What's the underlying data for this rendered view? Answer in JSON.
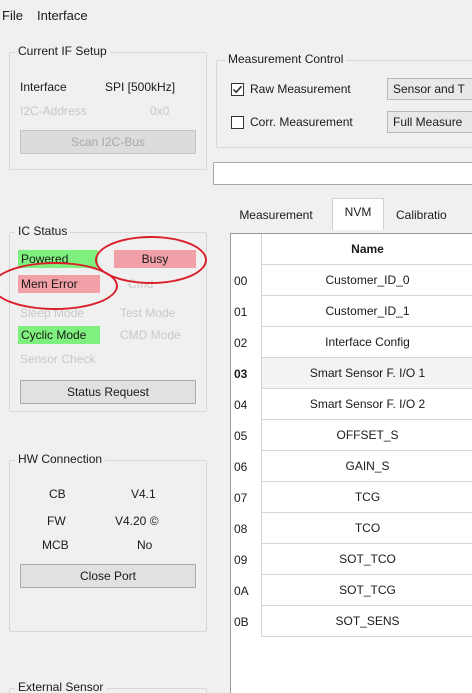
{
  "menu": {
    "file": "File",
    "interface": "Interface"
  },
  "current_if": {
    "title": "Current IF Setup",
    "interface_label": "Interface",
    "interface_value": "SPI [500kHz]",
    "i2c_label": "I2C-Address",
    "i2c_value": "0x0",
    "scan_button": "Scan I2C-Bus"
  },
  "ic_status": {
    "title": "IC Status",
    "powered": "Powered",
    "busy": "Busy",
    "mem_error": "Mem Error",
    "hidden_behind": "Cmd",
    "sleep_mode": "Sleep Mode",
    "test_mode": "Test Mode",
    "cyclic_mode": "Cyclic Mode",
    "cmd_mode": "CMD Mode",
    "sensor_check": "Sensor Check",
    "status_request": "Status Request"
  },
  "hw_connection": {
    "title": "HW Connection",
    "rows": [
      {
        "label": "CB",
        "value": "V4.1"
      },
      {
        "label": "FW",
        "value": "V4.20 ©"
      },
      {
        "label": "MCB",
        "value": "No"
      }
    ],
    "close_port": "Close Port"
  },
  "external_sensor": {
    "title": "External Sensor"
  },
  "measurement_control": {
    "title": "Measurement Control",
    "raw_label": "Raw Measurement",
    "raw_checked": true,
    "raw_mode": "Sensor and T",
    "corr_label": "Corr. Measurement",
    "corr_checked": false,
    "corr_mode": "Full Measure"
  },
  "tabs": [
    {
      "label": "Measurement",
      "active": false
    },
    {
      "label": "NVM",
      "active": true
    },
    {
      "label": "Calibratio",
      "active": false
    }
  ],
  "grid": {
    "column_header": "Name",
    "rows": [
      {
        "addr": "00",
        "name": "Customer_ID_0",
        "bold": false
      },
      {
        "addr": "01",
        "name": "Customer_ID_1",
        "bold": false
      },
      {
        "addr": "02",
        "name": "Interface Config",
        "bold": false
      },
      {
        "addr": "03",
        "name": "Smart Sensor F. I/O 1",
        "bold": true
      },
      {
        "addr": "04",
        "name": "Smart Sensor F. I/O 2",
        "bold": false
      },
      {
        "addr": "05",
        "name": "OFFSET_S",
        "bold": false
      },
      {
        "addr": "06",
        "name": "GAIN_S",
        "bold": false
      },
      {
        "addr": "07",
        "name": "TCG",
        "bold": false
      },
      {
        "addr": "08",
        "name": "TCO",
        "bold": false
      },
      {
        "addr": "09",
        "name": "SOT_TCO",
        "bold": false
      },
      {
        "addr": "0A",
        "name": "SOT_TCG",
        "bold": false
      },
      {
        "addr": "0B",
        "name": "SOT_SENS",
        "bold": false
      }
    ]
  },
  "colors": {
    "status_green": "#7ef07e",
    "status_pink": "#f0a0a6",
    "annotation_red": "#d9202a"
  }
}
